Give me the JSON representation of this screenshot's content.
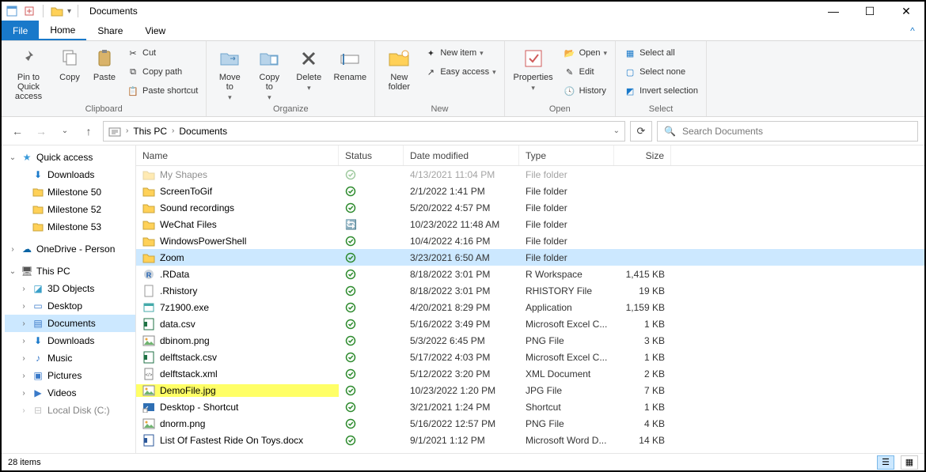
{
  "title": "Documents",
  "tabs": {
    "file": "File",
    "home": "Home",
    "share": "Share",
    "view": "View"
  },
  "ribbon": {
    "clipboard": {
      "label": "Clipboard",
      "pin": "Pin to Quick\naccess",
      "copy": "Copy",
      "paste": "Paste",
      "cut": "Cut",
      "copypath": "Copy path",
      "pasteshort": "Paste shortcut"
    },
    "organize": {
      "label": "Organize",
      "moveto": "Move\nto",
      "copyto": "Copy\nto",
      "delete": "Delete",
      "rename": "Rename"
    },
    "new": {
      "label": "New",
      "newfolder": "New\nfolder",
      "newitem": "New item",
      "easyaccess": "Easy access"
    },
    "open": {
      "label": "Open",
      "properties": "Properties",
      "open": "Open",
      "edit": "Edit",
      "history": "History"
    },
    "select": {
      "label": "Select",
      "all": "Select all",
      "none": "Select none",
      "invert": "Invert selection"
    }
  },
  "breadcrumb": {
    "root": "This PC",
    "current": "Documents"
  },
  "search_placeholder": "Search Documents",
  "tree": {
    "quick": "Quick access",
    "downloads": "Downloads",
    "m50": "Milestone 50",
    "m52": "Milestone 52",
    "m53": "Milestone 53",
    "onedrive": "OneDrive - Person",
    "thispc": "This PC",
    "obj3d": "3D Objects",
    "desktop": "Desktop",
    "documents": "Documents",
    "downloads2": "Downloads",
    "music": "Music",
    "pictures": "Pictures",
    "videos": "Videos",
    "localdisk": "Local Disk (C:)"
  },
  "columns": {
    "name": "Name",
    "status": "Status",
    "date": "Date modified",
    "type": "Type",
    "size": "Size"
  },
  "files": [
    {
      "ico": "folder",
      "name": "My Shapes",
      "st": "ok",
      "date": "4/13/2021 11:04 PM",
      "type": "File folder",
      "size": "",
      "dim": true
    },
    {
      "ico": "folder",
      "name": "ScreenToGif",
      "st": "ok",
      "date": "2/1/2022 1:41 PM",
      "type": "File folder",
      "size": ""
    },
    {
      "ico": "folder",
      "name": "Sound recordings",
      "st": "ok",
      "date": "5/20/2022 4:57 PM",
      "type": "File folder",
      "size": ""
    },
    {
      "ico": "folder",
      "name": "WeChat Files",
      "st": "sync",
      "date": "10/23/2022 11:48 AM",
      "type": "File folder",
      "size": ""
    },
    {
      "ico": "folder",
      "name": "WindowsPowerShell",
      "st": "ok",
      "date": "10/4/2022 4:16 PM",
      "type": "File folder",
      "size": ""
    },
    {
      "ico": "folder",
      "name": "Zoom",
      "st": "ok",
      "date": "3/23/2021 6:50 AM",
      "type": "File folder",
      "size": "",
      "sel": true
    },
    {
      "ico": "r",
      "name": ".RData",
      "st": "ok",
      "date": "8/18/2022 3:01 PM",
      "type": "R Workspace",
      "size": "1,415 KB"
    },
    {
      "ico": "file",
      "name": ".Rhistory",
      "st": "ok",
      "date": "8/18/2022 3:01 PM",
      "type": "RHISTORY File",
      "size": "19 KB"
    },
    {
      "ico": "exe",
      "name": "7z1900.exe",
      "st": "ok",
      "date": "4/20/2021 8:29 PM",
      "type": "Application",
      "size": "1,159 KB"
    },
    {
      "ico": "xls",
      "name": "data.csv",
      "st": "ok",
      "date": "5/16/2022 3:49 PM",
      "type": "Microsoft Excel C...",
      "size": "1 KB"
    },
    {
      "ico": "png",
      "name": "dbinom.png",
      "st": "ok",
      "date": "5/3/2022 6:45 PM",
      "type": "PNG File",
      "size": "3 KB"
    },
    {
      "ico": "xls",
      "name": "delftstack.csv",
      "st": "ok",
      "date": "5/17/2022 4:03 PM",
      "type": "Microsoft Excel C...",
      "size": "1 KB"
    },
    {
      "ico": "xml",
      "name": "delftstack.xml",
      "st": "ok",
      "date": "5/12/2022 3:20 PM",
      "type": "XML Document",
      "size": "2 KB"
    },
    {
      "ico": "jpg",
      "name": "DemoFile.jpg",
      "st": "ok",
      "date": "10/23/2022 1:20 PM",
      "type": "JPG File",
      "size": "7 KB",
      "hl": true
    },
    {
      "ico": "lnk",
      "name": "Desktop - Shortcut",
      "st": "ok",
      "date": "3/21/2021 1:24 PM",
      "type": "Shortcut",
      "size": "1 KB"
    },
    {
      "ico": "png",
      "name": "dnorm.png",
      "st": "ok",
      "date": "5/16/2022 12:57 PM",
      "type": "PNG File",
      "size": "4 KB"
    },
    {
      "ico": "doc",
      "name": "List Of Fastest Ride On Toys.docx",
      "st": "ok",
      "date": "9/1/2021 1:12 PM",
      "type": "Microsoft Word D...",
      "size": "14 KB"
    }
  ],
  "status": {
    "items": "28 items"
  }
}
